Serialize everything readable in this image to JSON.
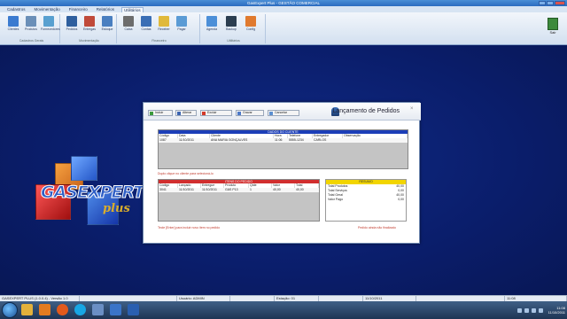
{
  "window": {
    "title": "GasExpert Plus - GESTÃO COMERCIAL"
  },
  "menu": [
    "Cadastros",
    "Movimentação",
    "Financeiro",
    "Relatórios",
    "Utilitários"
  ],
  "ribbon": {
    "groups": [
      {
        "label": "Cadastros Gerais"
      },
      {
        "label": "Movimentação"
      },
      {
        "label": "Financeiro"
      },
      {
        "label": "Utilitários"
      }
    ],
    "buttons": [
      {
        "label": "Clientes",
        "icon": "clients-icon",
        "color": "#3b7bd0"
      },
      {
        "label": "Produtos",
        "icon": "products-icon",
        "color": "#6a8fb8"
      },
      {
        "label": "Fornecedores",
        "icon": "suppliers-icon",
        "color": "#58a0d0"
      },
      {
        "label": "Pedidos",
        "icon": "orders-icon",
        "color": "#2f5f9e"
      },
      {
        "label": "Entregas",
        "icon": "delivery-icon",
        "color": "#c04a3a"
      },
      {
        "label": "Estoque",
        "icon": "stock-icon",
        "color": "#4a7fc0"
      },
      {
        "label": "Caixa",
        "icon": "cashier-icon",
        "color": "#6d6d6d"
      },
      {
        "label": "Contas",
        "icon": "accounts-icon",
        "color": "#3a6eb5"
      },
      {
        "label": "Receber",
        "icon": "receive-icon",
        "color": "#e0b93b"
      },
      {
        "label": "Pagar",
        "icon": "pay-icon",
        "color": "#5a9bd5"
      },
      {
        "label": "Agenda",
        "icon": "agenda-icon",
        "color": "#4c8fd8"
      },
      {
        "label": "Backup",
        "icon": "backup-icon",
        "color": "#2c3e50"
      },
      {
        "label": "Config",
        "icon": "config-icon",
        "color": "#e07a2f"
      }
    ],
    "exit_label": "Sair"
  },
  "logo": {
    "name": "GASEXPERT",
    "suffix": "plus"
  },
  "dialog": {
    "title": "Lançamento de Pedidos",
    "toolbar": [
      "Incluir",
      "Alterar",
      "Excluir",
      "Gravar",
      "Cancelar"
    ],
    "clients_panel": {
      "header": "DADOS DO CLIENTE",
      "columns": [
        "Código",
        "Data",
        "Cliente",
        "Hora",
        "Telefone",
        "Entregador",
        "Observação"
      ],
      "row": [
        "1087",
        "11/10/2011",
        "ANA MARIA GONÇALVES",
        "11:06",
        "5555-1234",
        "CARLOS",
        ""
      ]
    },
    "clients_note": "Duplo clique no cliente para selecioná-lo",
    "items_panel": {
      "header": "ITENS DO PEDIDO",
      "columns": [
        "Código",
        "Lançado",
        "Entregue",
        "Produto",
        "Qtde",
        "Valor",
        "Total"
      ],
      "row": [
        "3041",
        "11/10/2011",
        "11/10/2011",
        "GÁS P13",
        "1",
        "40,00",
        "40,00"
      ]
    },
    "items_note": "Tecle [Enter] para incluir novo item no pedido",
    "summary": {
      "header": "RESUMO",
      "rows": [
        {
          "label": "Total Produtos",
          "value": "40,00"
        },
        {
          "label": "Total Serviços",
          "value": "0,00"
        },
        {
          "label": "Total Geral",
          "value": "40,00"
        },
        {
          "label": "Valor Pago",
          "value": "0,00"
        }
      ],
      "note": "Pedido ainda não finalizado"
    }
  },
  "statusbar": [
    "GASEXPERT PLUS  (1.0.0.4) - Versão 1.0",
    "",
    "Usuário: ADMIN",
    "",
    "Estação: 01",
    "",
    "11/10/2011",
    "",
    "11:08"
  ],
  "taskbar": {
    "icons": [
      {
        "name": "explorer-icon",
        "color": "#e3b13b"
      },
      {
        "name": "media-player-icon",
        "color": "#e47b1f"
      },
      {
        "name": "firefox-icon",
        "color": "#e25a1c"
      },
      {
        "name": "skype-icon",
        "color": "#18a6e4"
      },
      {
        "name": "control-panel-icon",
        "color": "#6b8fc4"
      },
      {
        "name": "gasexpert-icon",
        "color": "#3a74c8"
      },
      {
        "name": "word-icon",
        "color": "#2a5fb0"
      }
    ],
    "time": "11:08",
    "date": "11/10/2011"
  }
}
